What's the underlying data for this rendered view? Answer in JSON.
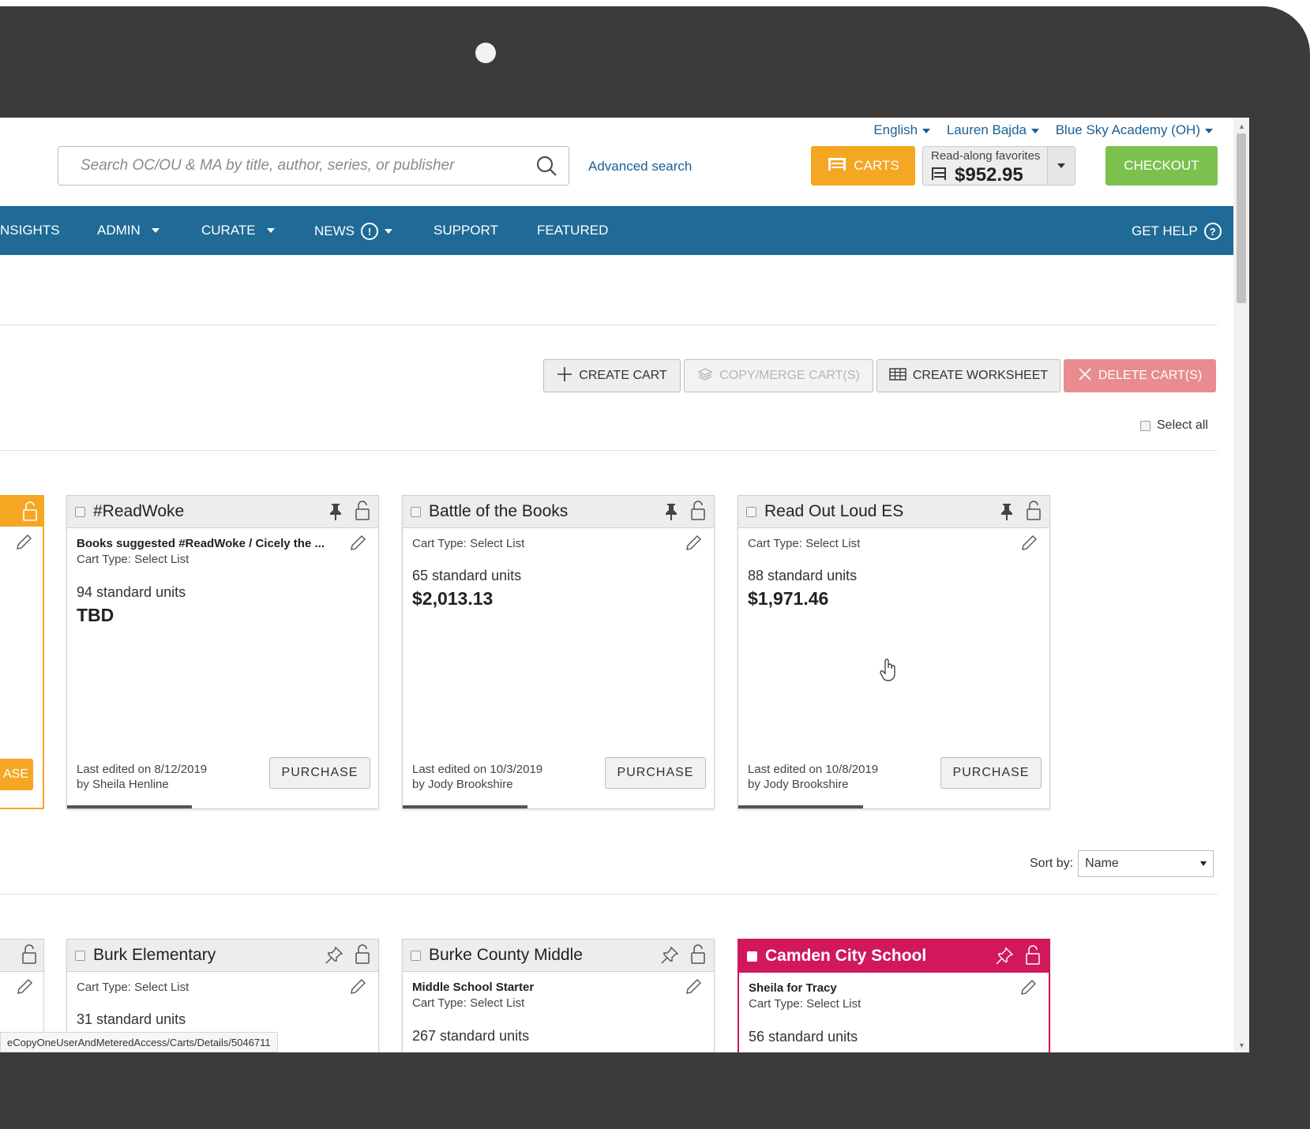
{
  "header": {
    "language": "English",
    "user": "Lauren Bajda",
    "school": "Blue Sky Academy (OH)",
    "search_placeholder": "Search OC/OU & MA by title, author, series, or publisher",
    "advanced_search": "Advanced search",
    "carts_label": "CARTS",
    "cart_name": "Read-along favorites",
    "cart_amount": "$952.95",
    "checkout_label": "CHECKOUT"
  },
  "nav": {
    "insights": "NSIGHTS",
    "admin": "ADMIN",
    "curate": "CURATE",
    "news": "NEWS",
    "support": "SUPPORT",
    "featured": "FEATURED",
    "get_help": "GET HELP"
  },
  "actions": {
    "create_cart": "CREATE CART",
    "copy_merge": "COPY/MERGE CART(S)",
    "create_worksheet": "CREATE WORKSHEET",
    "delete_carts": "DELETE CART(S)",
    "select_all": "Select all"
  },
  "pinned_cards": [
    {
      "title": "#ReadWoke",
      "description": "Books suggested #ReadWoke / Cicely the ...",
      "cart_type": "Cart Type: Select List",
      "units": "94 standard units",
      "price": "TBD",
      "edited_date": "Last edited on 8/12/2019",
      "edited_by": "by Sheila Henline",
      "purchase": "PURCHASE"
    },
    {
      "title": "Battle of the Books",
      "cart_type": "Cart Type: Select List",
      "units": "65 standard units",
      "price": "$2,013.13",
      "edited_date": "Last edited on 10/3/2019",
      "edited_by": "by Jody Brookshire",
      "purchase": "PURCHASE"
    },
    {
      "title": "Read Out Loud ES",
      "cart_type": "Cart Type: Select List",
      "units": "88 standard units",
      "price": "$1,971.46",
      "edited_date": "Last edited on 10/8/2019",
      "edited_by": "by Jody Brookshire",
      "purchase": "PURCHASE"
    }
  ],
  "partial_purchase": "ASE",
  "sort": {
    "label": "Sort by:",
    "value": "Name"
  },
  "cards": [
    {
      "title": "Burk Elementary",
      "cart_type": "Cart Type: Select List",
      "units": "31 standard units"
    },
    {
      "title": "Burke County Middle",
      "description": "Middle School Starter",
      "cart_type": "Cart Type: Select List",
      "units": "267 standard units"
    },
    {
      "title": "Camden City School",
      "description": "Sheila for Tracy",
      "cart_type": "Cart Type: Select List",
      "units": "56 standard units"
    }
  ],
  "status_url": "eCopyOneUserAndMeteredAccess/Carts/Details/5046711",
  "colors": {
    "nav": "#1f6a96",
    "carts_button": "#f5a623",
    "checkout_button": "#7cc14e",
    "delete_button": "#e88c8f",
    "magenta_card": "#d0185b"
  }
}
